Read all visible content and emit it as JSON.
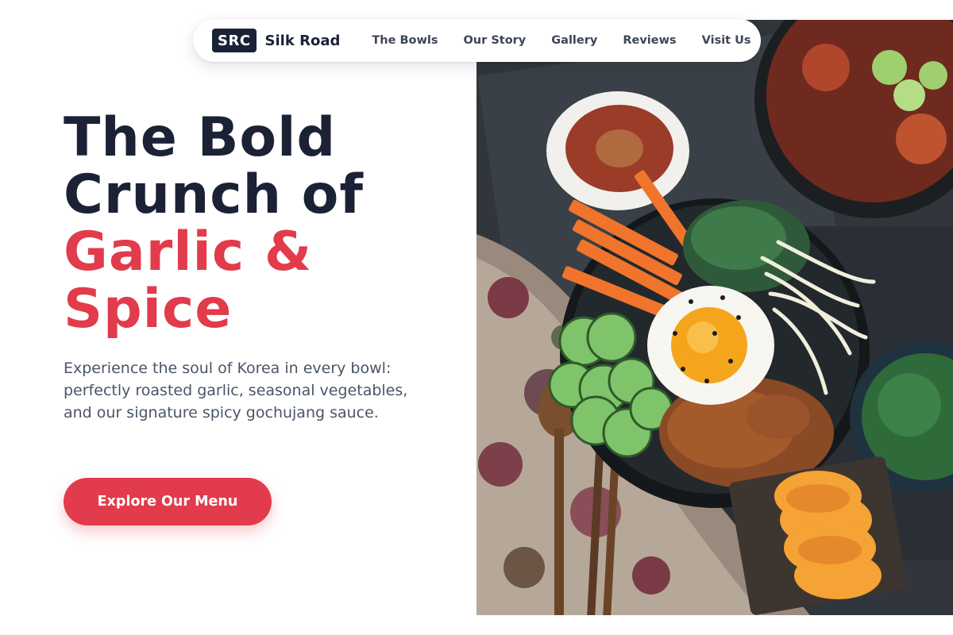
{
  "brand": {
    "badge": "SRC",
    "name": "Silk Road"
  },
  "nav": {
    "items": [
      {
        "label": "The Bowls"
      },
      {
        "label": "Our Story"
      },
      {
        "label": "Gallery"
      },
      {
        "label": "Reviews"
      },
      {
        "label": "Visit Us"
      }
    ]
  },
  "hero": {
    "headline_line1": "The Bold",
    "headline_line2": "Crunch of",
    "headline_accent1": "Garlic &",
    "headline_accent2": "Spice",
    "description": "Experience the soul of Korea in every bowl: perfectly roasted garlic, seasonal vegetables, and our signature spicy gochujang sauce.",
    "cta_label": "Explore Our Menu"
  },
  "colors": {
    "brand_dark": "#1b2236",
    "accent": "#e23b4c",
    "body_text": "#4a5568",
    "nav_text": "#3d4656"
  },
  "icons": {
    "hero_image": "bibimbap-bowl-photo"
  }
}
